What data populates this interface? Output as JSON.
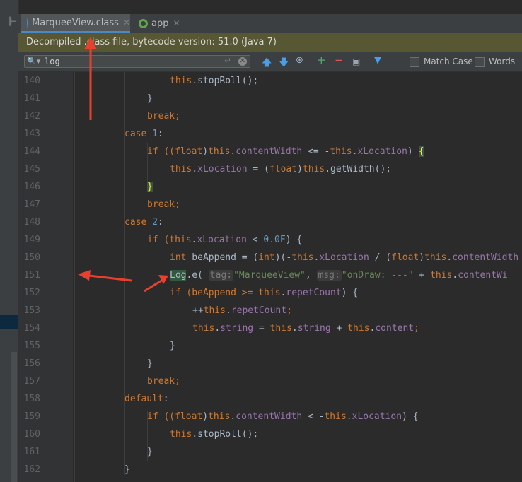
{
  "tabs": [
    {
      "label": "MarqueeView.class",
      "active": true,
      "icon": "class-icon",
      "icon_color": "#4a88c7"
    },
    {
      "label": "app",
      "active": false,
      "icon": "android-module-icon",
      "icon_color": "#5fa54b"
    }
  ],
  "banner": {
    "text": "Decompiled .class file, bytecode version: 51.0 (Java 7)"
  },
  "find": {
    "query": "log",
    "match_case_label": "Match Case",
    "words_label": "Words"
  },
  "lines": [
    {
      "n": "140"
    },
    {
      "n": "141"
    },
    {
      "n": "142"
    },
    {
      "n": "143"
    },
    {
      "n": "144"
    },
    {
      "n": "145"
    },
    {
      "n": "146"
    },
    {
      "n": "147"
    },
    {
      "n": "148"
    },
    {
      "n": "149"
    },
    {
      "n": "150"
    },
    {
      "n": "151"
    },
    {
      "n": "152"
    },
    {
      "n": "153"
    },
    {
      "n": "154"
    },
    {
      "n": "155"
    },
    {
      "n": "156"
    },
    {
      "n": "157"
    },
    {
      "n": "158"
    },
    {
      "n": "159"
    },
    {
      "n": "160"
    },
    {
      "n": "161"
    },
    {
      "n": "162"
    }
  ],
  "code": {
    "l140": {
      "a": "this",
      "b": ".stopRoll();"
    },
    "l141": {
      "a": "}"
    },
    "l142": {
      "a": "break",
      "b": ";"
    },
    "l143": {
      "a": "case ",
      "b": "1",
      "c": ":"
    },
    "l144": {
      "a": "if ((",
      "b": "float",
      "c": ")",
      "d": "this",
      "e": ".",
      "f": "contentWidth",
      "g": " <= -",
      "h": "this",
      "i": ".",
      "j": "xLocation",
      "k": ") ",
      "l": "{"
    },
    "l145": {
      "a": "this",
      "b": ".",
      "c": "xLocation",
      "d": " = (",
      "e": "float",
      "f": ")",
      "g": "this",
      "h": ".getWidth();"
    },
    "l146": {
      "a": "}"
    },
    "l147": {
      "a": "break",
      "b": ";"
    },
    "l148": {
      "a": "case ",
      "b": "2",
      "c": ":"
    },
    "l149": {
      "a": "if (",
      "b": "this",
      "c": ".",
      "d": "xLocation",
      "e": " < ",
      "f": "0.0F",
      "g": ") {"
    },
    "l150": {
      "a": "int",
      "b": " beAppend = (",
      "c": "int",
      "d": ")(-",
      "e": "this",
      "f": ".",
      "g": "xLocation",
      "h": " / (",
      "i": "float",
      "j": ")",
      "k": "this",
      "l": ".",
      "m": "contentWidth"
    },
    "l151": {
      "a": "Log",
      "b": ".e( ",
      "c": "tag:",
      "d": "\"MarqueeView\"",
      "e": ", ",
      "f": "msg:",
      "g": "\"onDraw: ---\"",
      "h": " + ",
      "i": "this",
      "j": ".",
      "k": "contentWi"
    },
    "l152": {
      "a": "if (beAppend >= ",
      "b": "this",
      "c": ".",
      "d": "repetCount",
      "e": ") {"
    },
    "l153": {
      "a": "++",
      "b": "this",
      "c": ".",
      "d": "repetCount",
      "e": ";"
    },
    "l154": {
      "a": "this",
      "b": ".",
      "c": "string",
      "d": " = ",
      "e": "this",
      "f": ".",
      "g": "string",
      "h": " + ",
      "i": "this",
      "j": ".",
      "k": "content",
      "l": ";"
    },
    "l155": {
      "a": "}"
    },
    "l156": {
      "a": "}"
    },
    "l157": {
      "a": "break",
      "b": ";"
    },
    "l158": {
      "a": "default",
      "b": ":"
    },
    "l159": {
      "a": "if ((",
      "b": "float",
      "c": ")",
      "d": "this",
      "e": ".",
      "f": "contentWidth",
      "g": " < -",
      "h": "this",
      "i": ".",
      "j": "xLocation",
      "k": ") {"
    },
    "l160": {
      "a": "this",
      "b": ".stopRoll();"
    },
    "l161": {
      "a": "}"
    },
    "l162": {
      "a": "}"
    }
  },
  "colors": {
    "annotation_arrow": "#e8402f",
    "keyword": "#cc7832",
    "field": "#9876aa",
    "string": "#6a8759",
    "number": "#6897bb"
  }
}
